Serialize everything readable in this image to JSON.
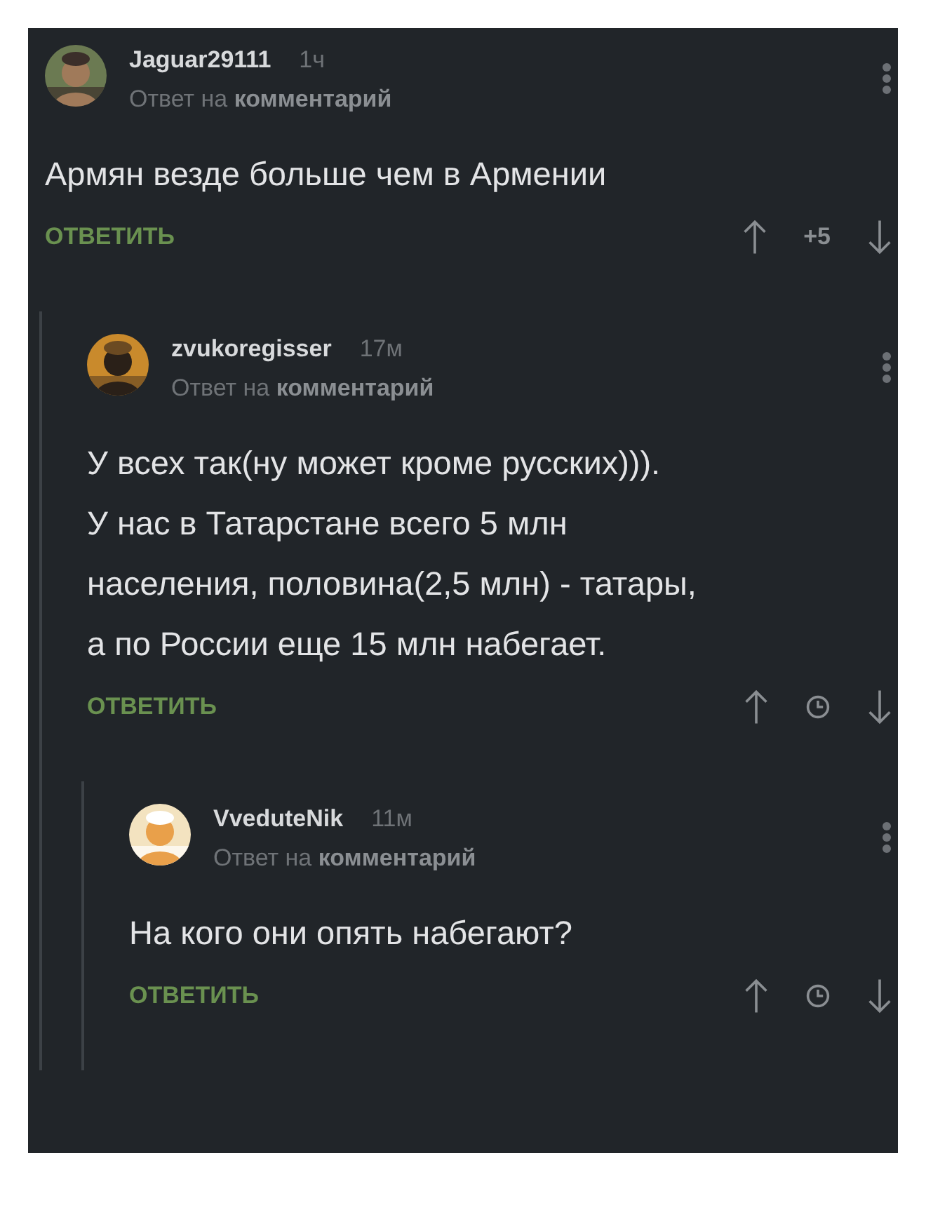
{
  "comments": [
    {
      "author": "Jaguar29111",
      "time": "1ч",
      "reply_to": "Ответ на **комментарий**",
      "text_lines": [
        "Армян везде больше чем в Армении"
      ],
      "reply_label": "ОТВЕТИТЬ",
      "rating": {
        "kind": "score",
        "text": "+5"
      },
      "children": [
        {
          "author": "zvukoregisser",
          "time": "17м",
          "reply_to": "Ответ на **комментарий**",
          "text_lines": [
            "У всех так(ну может кроме русских))).",
            "У нас в Татарстане всего 5 млн",
            "населения, половина(2,5 млн) - татары,",
            "а по России еще 15 млн набегает."
          ],
          "reply_label": "ОТВЕТИТЬ",
          "rating": {
            "kind": "pending"
          },
          "children": [
            {
              "author": "VveduteNik",
              "time": "11м",
              "reply_to": "Ответ на **комментарий**",
              "text_lines": [
                "На кого они опять набегают?"
              ],
              "reply_label": "ОТВЕТИТЬ",
              "rating": {
                "kind": "pending"
              }
            }
          ]
        }
      ]
    }
  ]
}
